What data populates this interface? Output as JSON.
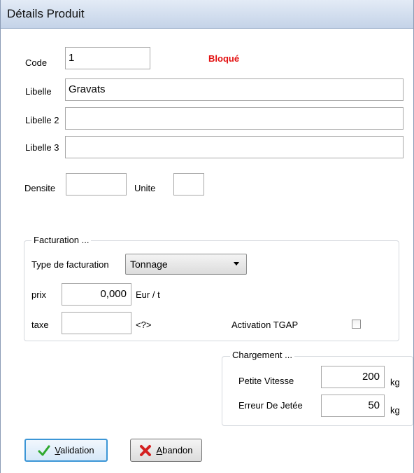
{
  "window": {
    "title": "Détails Produit"
  },
  "form": {
    "code": {
      "label": "Code",
      "value": "1"
    },
    "status": "Bloqué",
    "libelle": {
      "label": "Libelle",
      "value": "Gravats"
    },
    "libelle2": {
      "label": "Libelle 2",
      "value": ""
    },
    "libelle3": {
      "label": "Libelle 3",
      "value": ""
    },
    "densite": {
      "label": "Densite",
      "value": ""
    },
    "unite": {
      "label": "Unite",
      "value": ""
    }
  },
  "facturation": {
    "group_title": "Facturation ...",
    "type_label": "Type de facturation",
    "type_value": "Tonnage",
    "prix": {
      "label": "prix",
      "value": "0,000",
      "unit": "Eur / t"
    },
    "taxe": {
      "label": "taxe",
      "value": "",
      "unit": "<?>"
    },
    "tgap": {
      "label": "Activation TGAP",
      "checked": false
    }
  },
  "chargement": {
    "group_title": "Chargement ...",
    "petite_vitesse": {
      "label": "Petite Vitesse",
      "value": "200",
      "unit": "kg"
    },
    "erreur_jetee": {
      "label": "Erreur De Jetée",
      "value": "50",
      "unit": "kg"
    }
  },
  "buttons": {
    "validation": {
      "prefix": "",
      "accel": "V",
      "rest": "alidation"
    },
    "abandon": {
      "prefix": "",
      "accel": "A",
      "rest": "bandon"
    }
  },
  "colors": {
    "status": "#e31010",
    "accent": "#3c96d6",
    "check_icon": "#2ea82e",
    "cross_icon": "#d42020"
  }
}
